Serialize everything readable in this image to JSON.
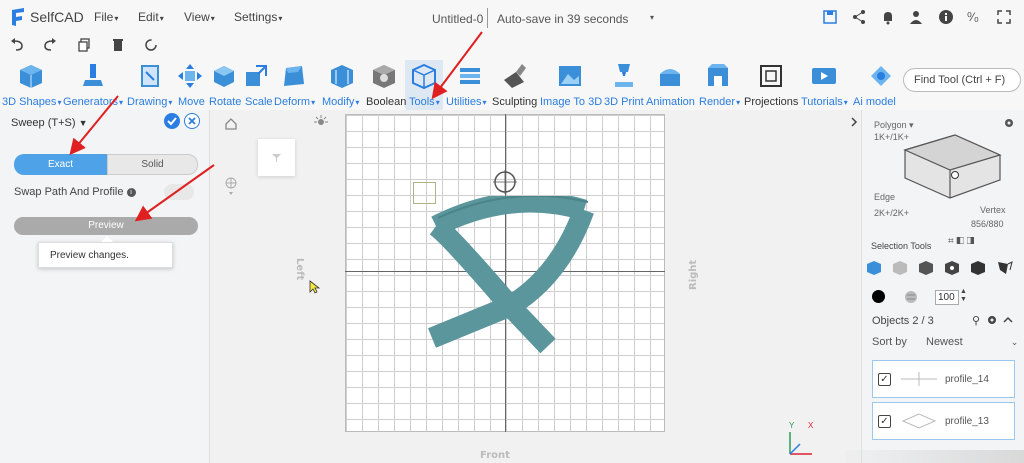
{
  "app": {
    "name": "SelfCAD",
    "menus": [
      {
        "label": "File"
      },
      {
        "label": "Edit"
      },
      {
        "label": "View"
      },
      {
        "label": "Settings"
      }
    ],
    "doc_title": "Untitled-0",
    "autosave": "Auto-save in 39 seconds"
  },
  "toolbar": {
    "tools": [
      {
        "label": "3D Shapes",
        "caret": true,
        "icon": "cube-icon"
      },
      {
        "label": "Generators",
        "caret": true,
        "icon": "generator-icon"
      },
      {
        "label": "Drawing",
        "caret": true,
        "icon": "drawing-icon"
      },
      {
        "label": "Move",
        "caret": false,
        "icon": "move-icon"
      },
      {
        "label": "Rotate",
        "caret": false,
        "icon": "rotate-icon"
      },
      {
        "label": "Scale",
        "caret": false,
        "icon": "scale-icon"
      },
      {
        "label": "Deform",
        "caret": true,
        "icon": "deform-icon"
      },
      {
        "label": "Modify",
        "caret": true,
        "icon": "modify-icon"
      },
      {
        "label": "Boolean",
        "caret": false,
        "icon": "boolean-icon"
      },
      {
        "label": "Tools",
        "caret": true,
        "icon": "tools-icon"
      },
      {
        "label": "Utilities",
        "caret": true,
        "icon": "utilities-icon"
      },
      {
        "label": "Sculpting",
        "caret": false,
        "icon": "sculpting-icon"
      },
      {
        "label": "Image To 3D",
        "caret": false,
        "icon": "image-to-3d-icon"
      },
      {
        "label": "3D Print",
        "caret": false,
        "icon": "3d-print-icon"
      },
      {
        "label": "Animation",
        "caret": false,
        "icon": "animation-icon"
      },
      {
        "label": "Render",
        "caret": true,
        "icon": "render-icon"
      },
      {
        "label": "Projections",
        "caret": false,
        "icon": "projections-icon"
      },
      {
        "label": "Tutorials",
        "caret": true,
        "icon": "tutorials-icon"
      },
      {
        "label": "Ai model",
        "caret": false,
        "icon": "ai-model-icon"
      }
    ],
    "find_tool": "Find Tool (Ctrl + F)"
  },
  "left_panel": {
    "title": "Sweep (T+S)",
    "exact_label": "Exact",
    "solid_label": "Solid",
    "swap_label": "Swap Path And Profile",
    "preview_label": "Preview",
    "tooltip": "Preview changes."
  },
  "viewport": {
    "left_label": "Left",
    "right_label": "Right",
    "front_label": "Front",
    "axis_x": "X",
    "axis_y": "Y"
  },
  "right_panel": {
    "polygon_label": "Polygon",
    "polygon_count": "1K+/1K+",
    "edge_label": "Edge",
    "edge_count": "2K+/2K+",
    "vertex_label": "Vertex",
    "vertex_count": "856/880",
    "selection_tools": "Selection Tools",
    "opacity_value": "100",
    "objects_count": "Objects 2 / 3",
    "sort_label": "Sort by",
    "sort_value": "Newest",
    "objects": [
      {
        "name": "profile_14",
        "checked": true
      },
      {
        "name": "profile_13",
        "checked": true
      }
    ]
  },
  "colors": {
    "accent": "#2a7de1",
    "model": "#5a969c",
    "toggle_active": "#4ea3e8",
    "annotation_arrow": "#e02020"
  }
}
